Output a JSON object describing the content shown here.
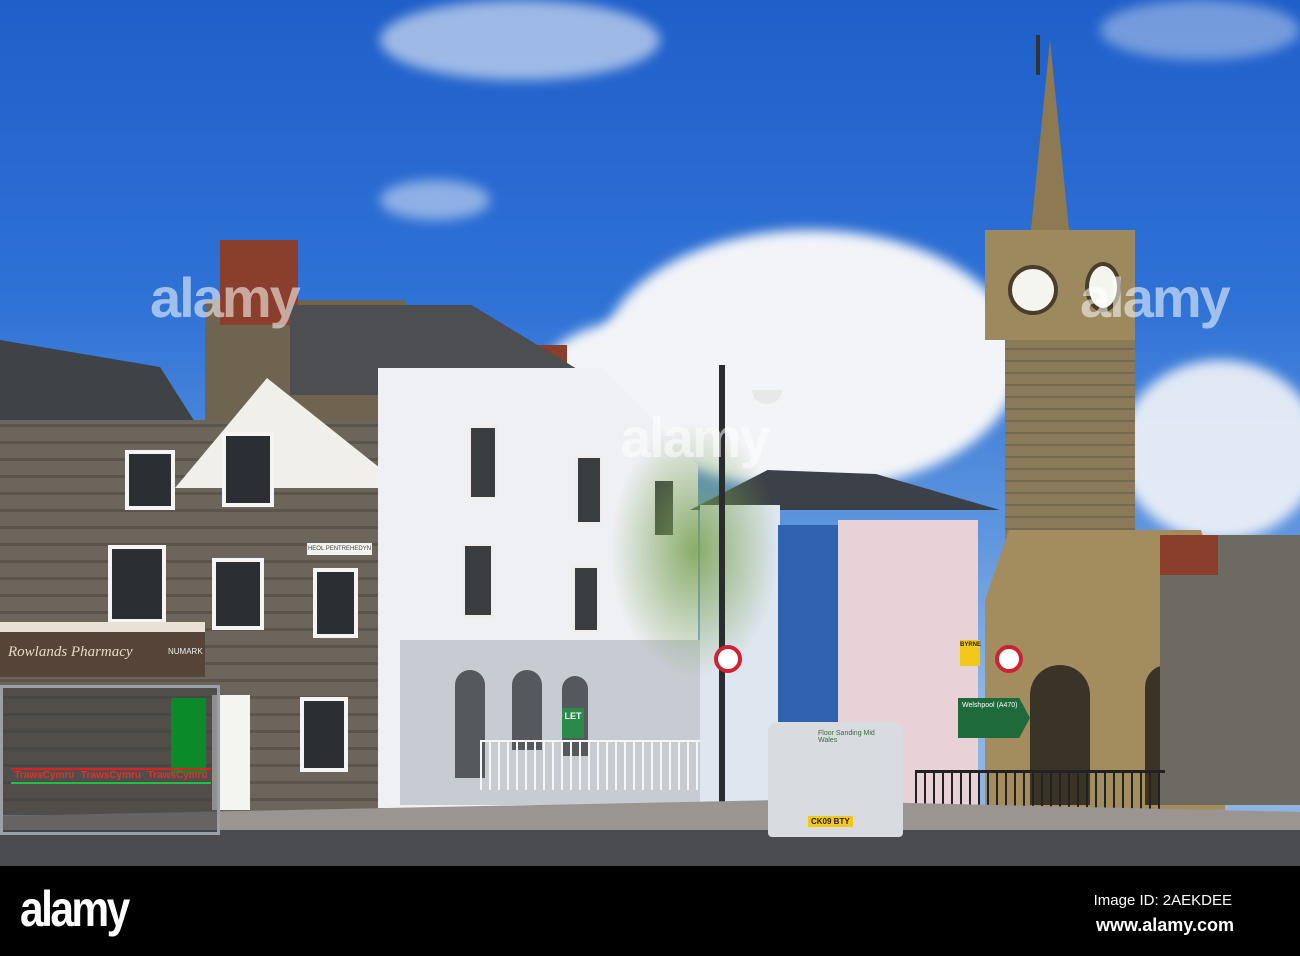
{
  "watermark": {
    "logo": "alamy",
    "image_id": "Image ID: 2AEKDEE",
    "url": "www.alamy.com"
  },
  "scene": {
    "street_sign": "HEOL PENTREHEDYN",
    "pharmacy_sign": "Rowlands Pharmacy",
    "pharmacy_brand": "NUMARK",
    "bus_shelter_brand": [
      "TrawsCymru",
      "TrawsCymru",
      "TrawsCymru"
    ],
    "letting_sign": "LET",
    "scaffold_sign": "BYRNE",
    "van_text": "Floor Sanding Mid Wales",
    "van_plate": "CK09 BTY",
    "direction_sign": "Welshpool (A470)"
  }
}
